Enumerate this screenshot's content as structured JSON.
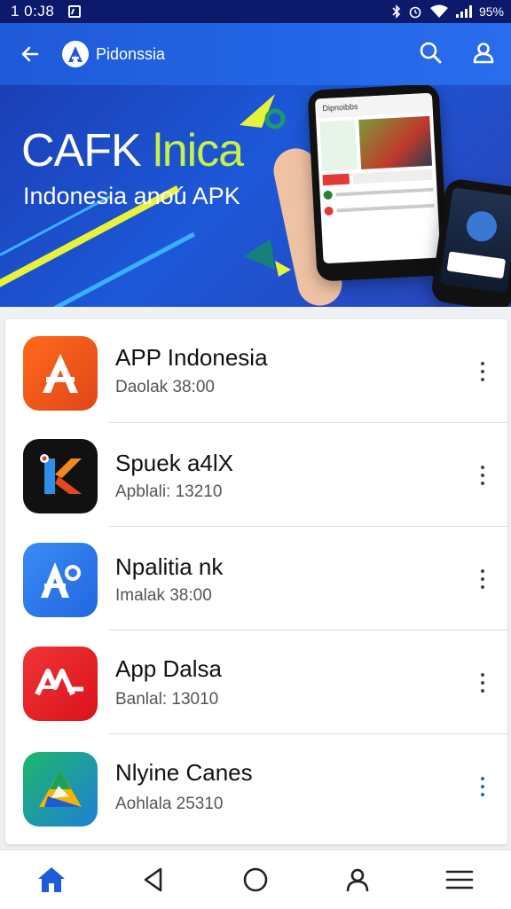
{
  "status_bar": {
    "time": "1 0:J8",
    "battery": "95%"
  },
  "app_bar": {
    "title": "Pidonssia",
    "back_icon": "arrow-left-icon",
    "search_icon": "search-icon",
    "profile_icon": "account-icon"
  },
  "banner": {
    "headline_white": "CAFK ",
    "headline_accent": "lnica",
    "subtitle": "Indonesia anoú APK",
    "phone_header": "Dipnoibbs"
  },
  "apps": [
    {
      "name": "APP Indonesia",
      "meta": "Daolak 38:00",
      "icon": "orange-a-app-icon",
      "color": "#f0541c"
    },
    {
      "name": "Spuek a4lX",
      "meta": "Apblali: 13210",
      "icon": "colorful-k-app-icon",
      "color": "#111111"
    },
    {
      "name": "Npalitia nk",
      "meta": "Imalak 38:00",
      "icon": "blue-a-app-icon",
      "color": "#2f7cf0"
    },
    {
      "name": "App Dalsa",
      "meta": "Banlal: 13010",
      "icon": "red-aa-app-icon",
      "color": "#e8212b"
    },
    {
      "name": "Nlyine Canes",
      "meta": "Aohlala 25310",
      "icon": "green-triangle-app-icon",
      "color": "#1da15a"
    }
  ],
  "bottom_nav": {
    "items": [
      "home-icon",
      "back-triangle-icon",
      "home-circle-icon",
      "account-icon",
      "menu-icon"
    ],
    "active_color": "#1f5ad8"
  }
}
